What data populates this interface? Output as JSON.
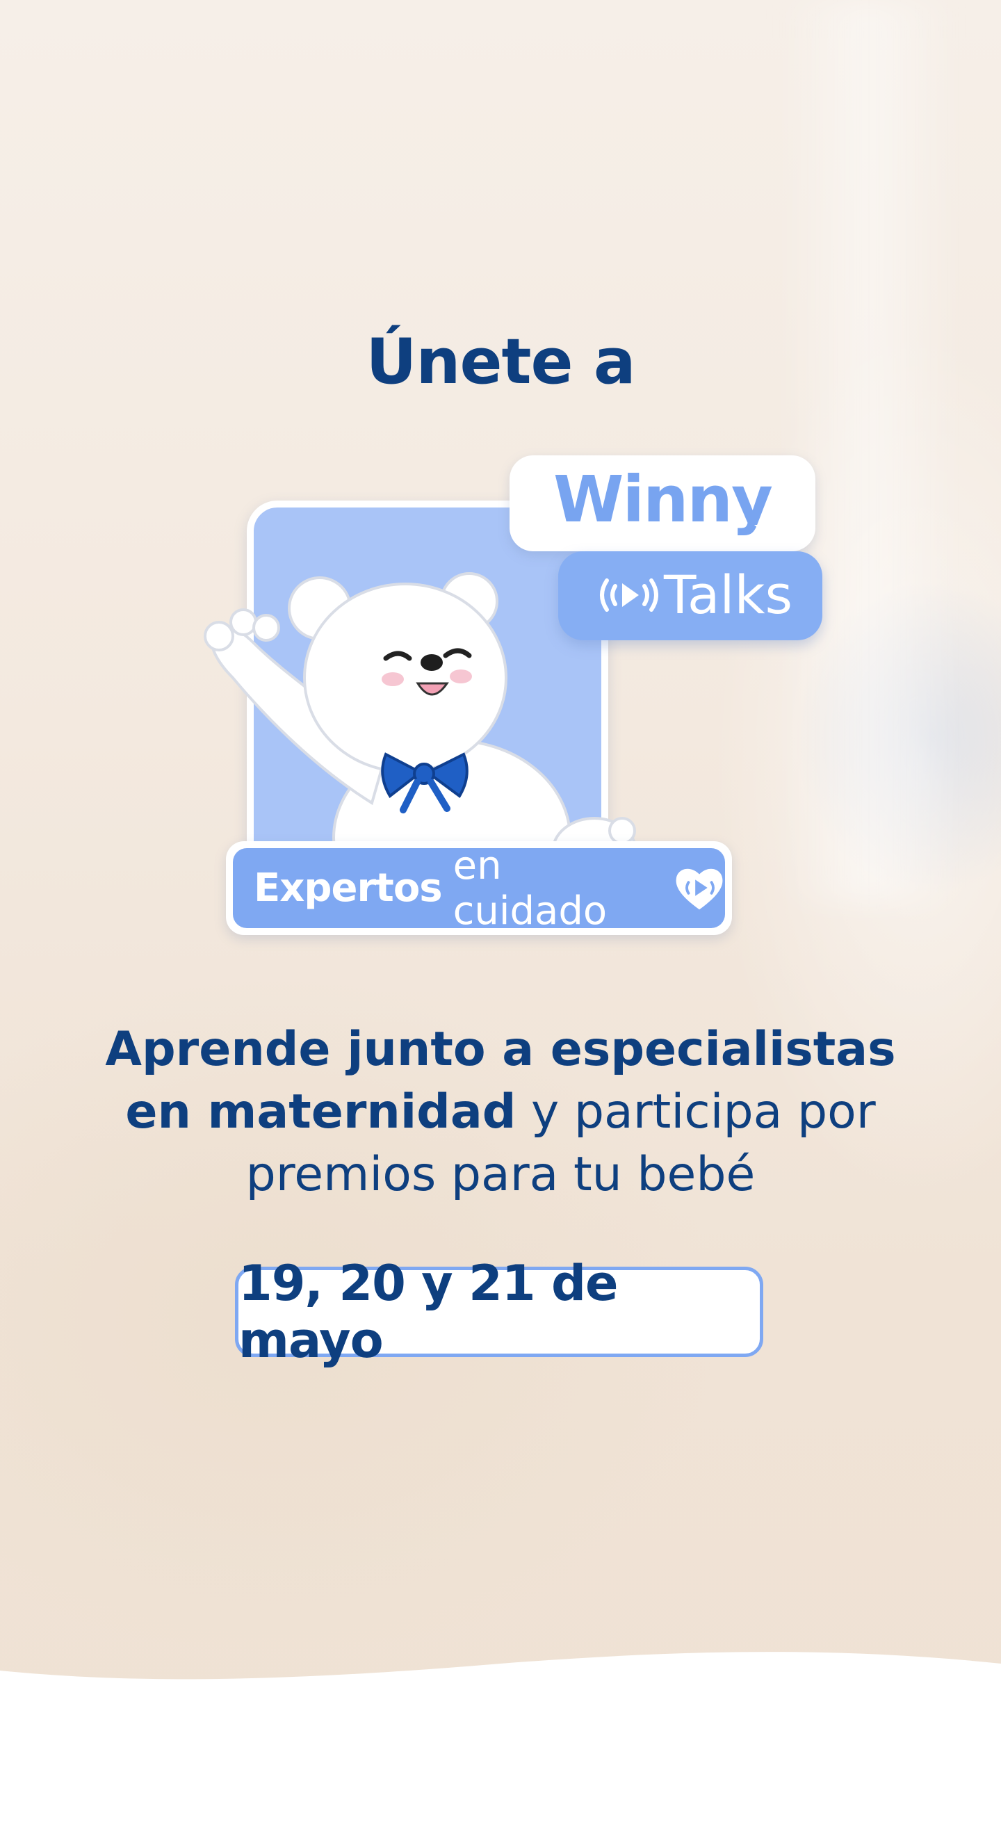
{
  "headline": "Únete a",
  "logo": {
    "winny": "Winny",
    "talks": "Talks",
    "banner_bold": "Expertos",
    "banner_regular": "en cuidado",
    "icons": [
      "broadcast-play-icon",
      "heart-play-icon",
      "polar-bear-mascot"
    ]
  },
  "tagline": {
    "bold": "Aprende junto a especialistas en maternidad",
    "regular": "y participa por premios para tu bebé"
  },
  "date": "19, 20 y 21 de mayo",
  "colors": {
    "navy": "#0e3f7f",
    "accent_blue": "#7fa8f2",
    "panel_blue": "#a9c4f7",
    "ribbon_blue": "#1f5fc5",
    "background": "#f4ebe2"
  }
}
